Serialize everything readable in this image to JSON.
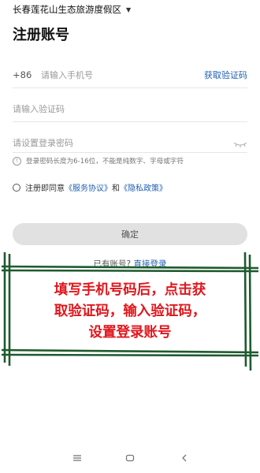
{
  "header": {
    "location": "长春莲花山生态旅游度假区",
    "title": "注册账号"
  },
  "phone": {
    "prefix": "+86",
    "placeholder": "请输入手机号",
    "get_code_label": "获取验证码"
  },
  "code": {
    "placeholder": "请输入验证码"
  },
  "password": {
    "placeholder": "请设置登录密码",
    "hint": "登录密码长度为6-16位，不能是纯数字、字母或字符"
  },
  "agreement": {
    "prefix": "注册即同意",
    "service_link": "《服务协议》",
    "and": "和",
    "privacy_link": "《隐私政策》"
  },
  "confirm_label": "确定",
  "login": {
    "prompt": "已有账号?",
    "link": "直接登录"
  },
  "annotation": {
    "lines": [
      "填写手机号码后，点击获",
      "取验证码，输入验证码，",
      "设置登录账号"
    ],
    "color": "#e0161c",
    "frame_color": "#1e5a2e"
  },
  "navbar": {
    "icons": [
      "menu-icon",
      "home-icon",
      "back-icon"
    ]
  }
}
